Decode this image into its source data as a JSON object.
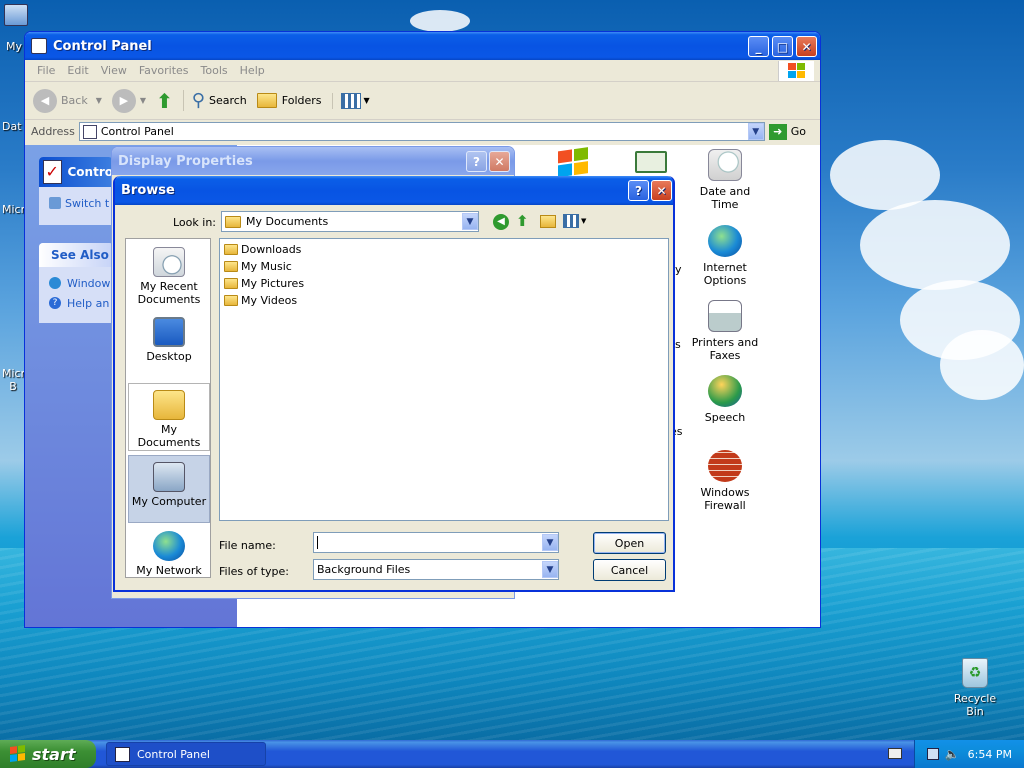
{
  "desktop": {
    "icons": [
      {
        "label": "My"
      },
      {
        "label": "Dat"
      },
      {
        "label": "Micr"
      },
      {
        "label": "Micr B"
      },
      {
        "label": "Recycle Bin"
      }
    ]
  },
  "control_panel": {
    "title": "Control Panel",
    "menu": [
      "File",
      "Edit",
      "View",
      "Favorites",
      "Tools",
      "Help"
    ],
    "toolbar": {
      "back": "Back",
      "search": "Search",
      "folders": "Folders"
    },
    "address_label": "Address",
    "address_value": "Control Panel",
    "go": "Go",
    "left_box_title": "Contro",
    "left_switch": "Switch t",
    "see_also_title": "See Also",
    "see_also_items": [
      "Window",
      "Help an"
    ],
    "icons": [
      {
        "label": "Date and Time"
      },
      {
        "label": "Internet Options"
      },
      {
        "label": "Printers and Faxes"
      },
      {
        "label": "Speech"
      },
      {
        "label": "Windows Firewall"
      }
    ],
    "partial_text": [
      "y",
      "ns",
      "es"
    ]
  },
  "display_properties": {
    "title": "Display Properties"
  },
  "browse": {
    "title": "Browse",
    "look_in_label": "Look in:",
    "look_in_value": "My Documents",
    "places": [
      {
        "label": "My Recent Documents"
      },
      {
        "label": "Desktop"
      },
      {
        "label": "My Documents"
      },
      {
        "label": "My Computer"
      },
      {
        "label": "My Network"
      }
    ],
    "files": [
      "Downloads",
      "My Music",
      "My Pictures",
      "My Videos"
    ],
    "file_name_label": "File name:",
    "file_name_value": "",
    "file_type_label": "Files of type:",
    "file_type_value": "Background Files",
    "open": "Open",
    "cancel": "Cancel"
  },
  "taskbar": {
    "start": "start",
    "task": "Control Panel",
    "clock": "6:54 PM"
  }
}
